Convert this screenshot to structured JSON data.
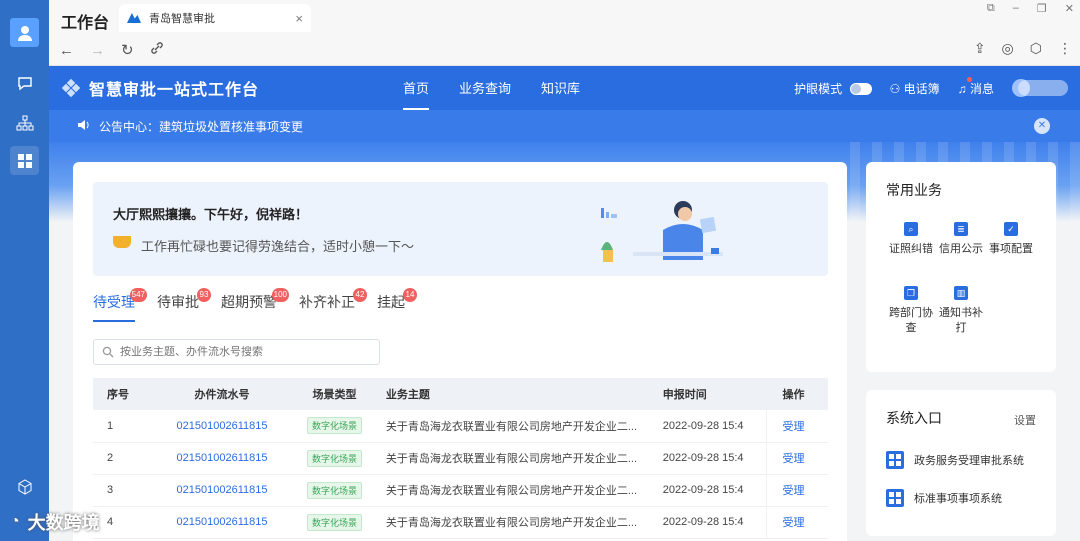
{
  "rail": {
    "items": [
      "avatar-icon",
      "chat-icon",
      "org-icon",
      "grid-icon",
      "cube-icon"
    ]
  },
  "browser": {
    "app_title": "工作台",
    "tab_title": "青岛智慧审批",
    "tab_close": "×",
    "nav": {
      "back": "←",
      "forward": "→",
      "refresh": "↻",
      "link": "🔗"
    },
    "right_icons": {
      "share": "⇪",
      "compass": "◎",
      "cube": "⬡",
      "more": "⋮"
    },
    "window_controls": [
      "⧉",
      "–",
      "❐",
      "✕"
    ]
  },
  "header": {
    "brand": "智慧审批一站式工作台",
    "menu": [
      "首页",
      "业务查询",
      "知识库"
    ],
    "active_menu_index": 0,
    "eye_mode_label": "护眼模式",
    "contacts_label": "电话簿",
    "messages_label": "消息"
  },
  "notice": {
    "text": "公告中心：建筑垃圾处置核准事项变更",
    "close": "✕"
  },
  "greeting": {
    "title": "大厅熙熙攘攘。下午好，倪祥路！",
    "subtitle": "工作再忙碌也要记得劳逸结合，适时小憩一下～"
  },
  "tabs": [
    {
      "label": "待受理",
      "badge": "547"
    },
    {
      "label": "待审批",
      "badge": "93"
    },
    {
      "label": "超期预警",
      "badge": "100"
    },
    {
      "label": "补齐补正",
      "badge": "42"
    },
    {
      "label": "挂起",
      "badge": "14"
    }
  ],
  "search": {
    "placeholder": "按业务主题、办件流水号搜索"
  },
  "table": {
    "headers": [
      "序号",
      "办件流水号",
      "场景类型",
      "业务主题",
      "申报时间",
      "操作"
    ],
    "rows": [
      {
        "no": "1",
        "flow": "021501002611815",
        "scene": "数字化场景",
        "topic": "关于青岛海龙衣联置业有限公司房地产开发企业二...",
        "date": "2022-09-28 15:4",
        "op": "受理"
      },
      {
        "no": "2",
        "flow": "021501002611815",
        "scene": "数字化场景",
        "topic": "关于青岛海龙衣联置业有限公司房地产开发企业二...",
        "date": "2022-09-28 15:4",
        "op": "受理"
      },
      {
        "no": "3",
        "flow": "021501002611815",
        "scene": "数字化场景",
        "topic": "关于青岛海龙衣联置业有限公司房地产开发企业二...",
        "date": "2022-09-28 15:4",
        "op": "受理"
      },
      {
        "no": "4",
        "flow": "021501002611815",
        "scene": "数字化场景",
        "topic": "关于青岛海龙衣联置业有限公司房地产开发企业二...",
        "date": "2022-09-28 15:4",
        "op": "受理"
      }
    ]
  },
  "common_biz": {
    "title": "常用业务",
    "items": [
      {
        "label": "证照纠错",
        "icon": "search-doc-icon"
      },
      {
        "label": "信用公示",
        "icon": "credit-icon"
      },
      {
        "label": "事项配置",
        "icon": "config-icon"
      },
      {
        "label": "跨部门协查",
        "icon": "copy-icon"
      },
      {
        "label": "通知书补打",
        "icon": "bank-icon"
      }
    ]
  },
  "system": {
    "title": "系统入口",
    "settings": "设置",
    "items": [
      "政务服务受理审批系统",
      "标准事项事项系统"
    ]
  },
  "watermark": {
    "text": "大数跨境"
  }
}
